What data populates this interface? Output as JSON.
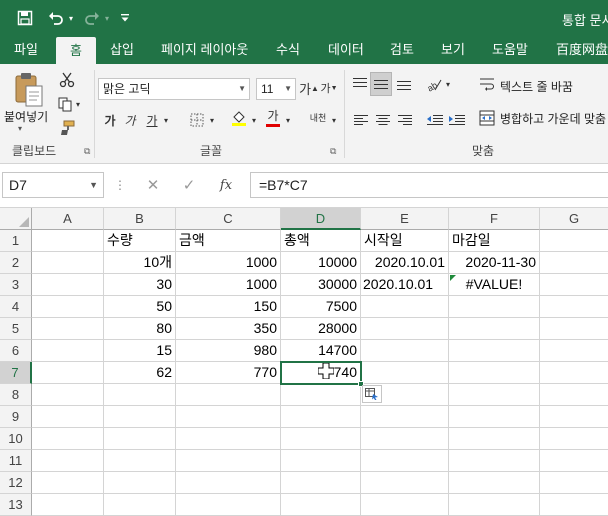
{
  "quick_access": {
    "save_icon": "save-icon",
    "undo_icon": "undo-icon",
    "redo_icon": "redo-icon",
    "customize_icon": "customize-qat-icon"
  },
  "window": {
    "title": "통합 문서"
  },
  "tabs": [
    {
      "label": "파일"
    },
    {
      "label": "홈"
    },
    {
      "label": "삽입"
    },
    {
      "label": "페이지 레이아웃"
    },
    {
      "label": "수식"
    },
    {
      "label": "데이터"
    },
    {
      "label": "검토"
    },
    {
      "label": "보기"
    },
    {
      "label": "도움말"
    },
    {
      "label": "百度网盘"
    }
  ],
  "ribbon": {
    "clipboard": {
      "paste_label": "붙여넣기",
      "group_label": "클립보드"
    },
    "font": {
      "font_name": "맑은 고딕",
      "font_size": "11",
      "bold": "가",
      "italic": "가",
      "underline": "가",
      "grow": "가",
      "shrink": "가",
      "font_color_glyph": "가",
      "phonetic": "내천",
      "group_label": "글꼴"
    },
    "alignment": {
      "wrap_text": "텍스트 줄 바꿈",
      "merge_center": "병합하고 가운데 맞춤",
      "group_label": "맞춤"
    }
  },
  "formula_bar": {
    "name_box": "D7",
    "fx_label": "fx",
    "formula": "=B7*C7"
  },
  "sheet": {
    "columns": [
      "A",
      "B",
      "C",
      "D",
      "E",
      "F",
      "G"
    ],
    "rows": [
      "1",
      "2",
      "3",
      "4",
      "5",
      "6",
      "7",
      "8",
      "9",
      "10",
      "11",
      "12",
      "13"
    ],
    "selected_cell": "D7",
    "cells": {
      "B1": "수량",
      "C1": "금액",
      "D1": "총액",
      "E1": "시작일",
      "F1": "마감일",
      "B2": "10개",
      "C2": "1000",
      "D2": "10000",
      "E2": "2020.10.01",
      "F2": "2020-11-30",
      "B3": "30",
      "C3": "1000",
      "D3": "30000",
      "E3": "2020.10.01",
      "F3": "#VALUE!",
      "B4": "50",
      "C4": "150",
      "D4": "7500",
      "B5": "80",
      "C5": "350",
      "D5": "28000",
      "B6": "15",
      "C6": "980",
      "D6": "14700",
      "B7": "62",
      "C7": "770",
      "D7": "740"
    }
  },
  "colors": {
    "brand": "#217346",
    "grid_line": "#d4d4d4",
    "header_bg": "#f3f3f3",
    "selected_header_bg": "#d2d2d2"
  }
}
